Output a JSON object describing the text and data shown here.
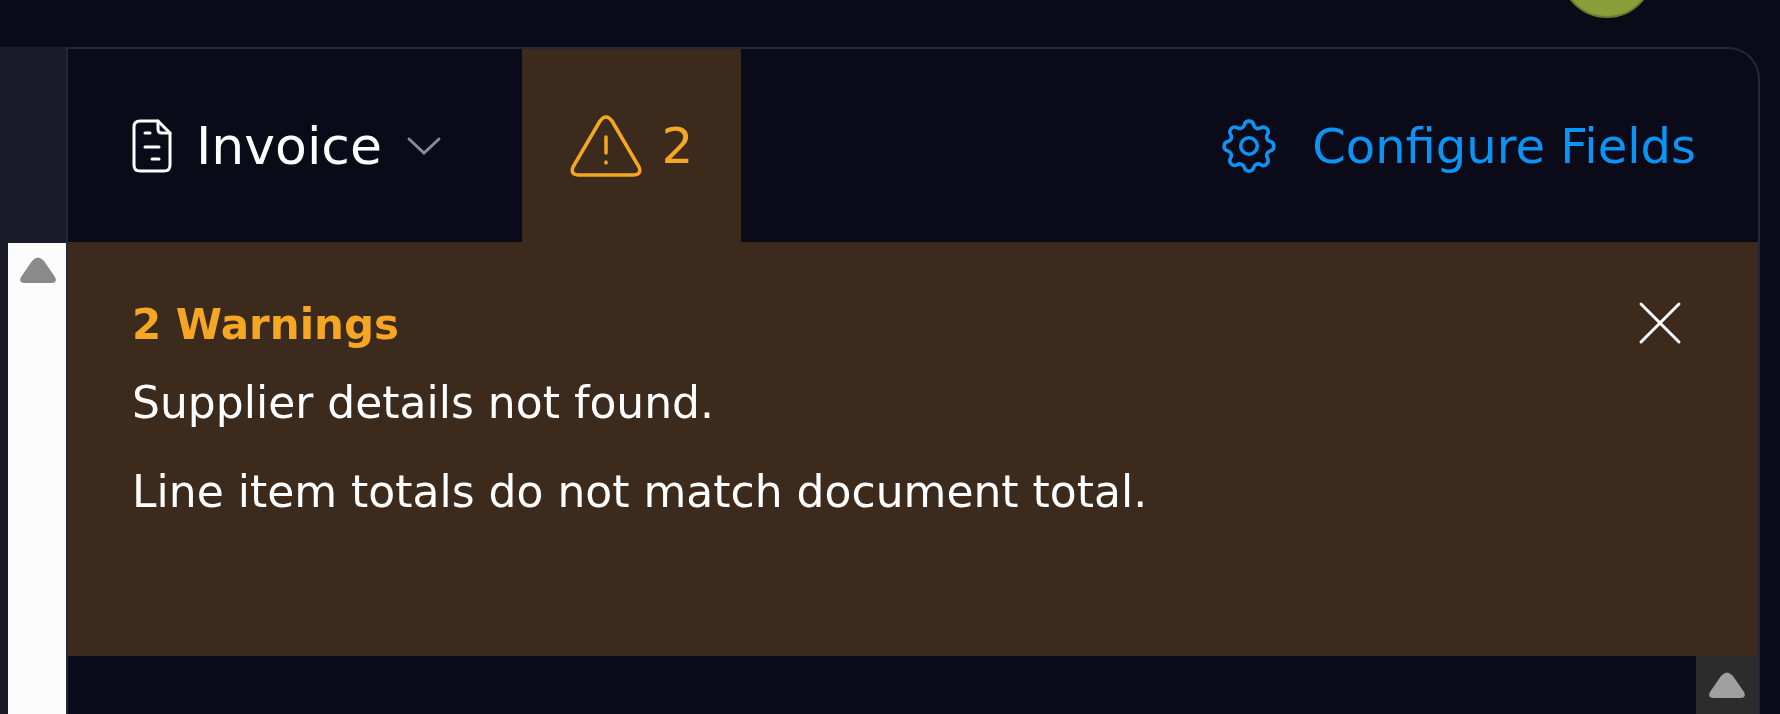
{
  "document_type": {
    "label": "Invoice"
  },
  "warnings_tab": {
    "count": "2",
    "selected": true
  },
  "configure": {
    "label": "Configure Fields"
  },
  "warnings_panel": {
    "title": "2 Warnings",
    "messages": [
      "Supplier details not found.",
      "Line item totals do not match document total."
    ]
  }
}
